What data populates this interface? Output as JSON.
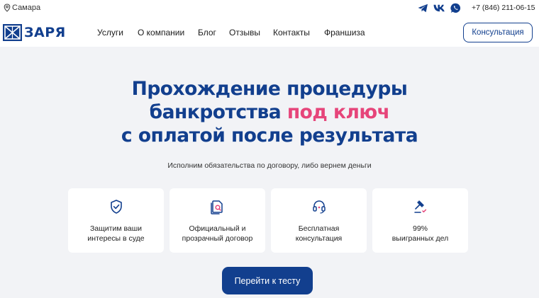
{
  "topbar": {
    "city": "Самара",
    "social": [
      {
        "name": "telegram-icon"
      },
      {
        "name": "vk-icon"
      },
      {
        "name": "whatsapp-icon"
      }
    ],
    "phone": "+7 (846) 211-06-15"
  },
  "header": {
    "logo_text": "ЗАРЯ",
    "nav": [
      "Услуги",
      "О компании",
      "Блог",
      "Отзывы",
      "Контакты",
      "Франшиза"
    ],
    "consult_button": "Консультация"
  },
  "hero": {
    "title_line1": "Прохождение процедуры",
    "title_line2_start": "банкротства ",
    "title_line2_accent": "под ключ",
    "title_line3": "с оплатой после результата",
    "subtitle": "Исполним обязательства по договору, либо вернем деньги"
  },
  "features": [
    {
      "icon": "shield-check-icon",
      "text": "Защитим ваши\nинтересы в суде"
    },
    {
      "icon": "document-search-icon",
      "text": "Официальный и\nпрозрачный договор"
    },
    {
      "icon": "headset-icon",
      "text": "Бесплатная\nконсультация"
    },
    {
      "icon": "gavel-icon",
      "text": "99%\nвыигранных дел"
    }
  ],
  "cta": {
    "label": "Перейти к тесту"
  },
  "colors": {
    "brand": "#123f8e",
    "accent": "#e6457a",
    "background": "#f2f3f6"
  }
}
